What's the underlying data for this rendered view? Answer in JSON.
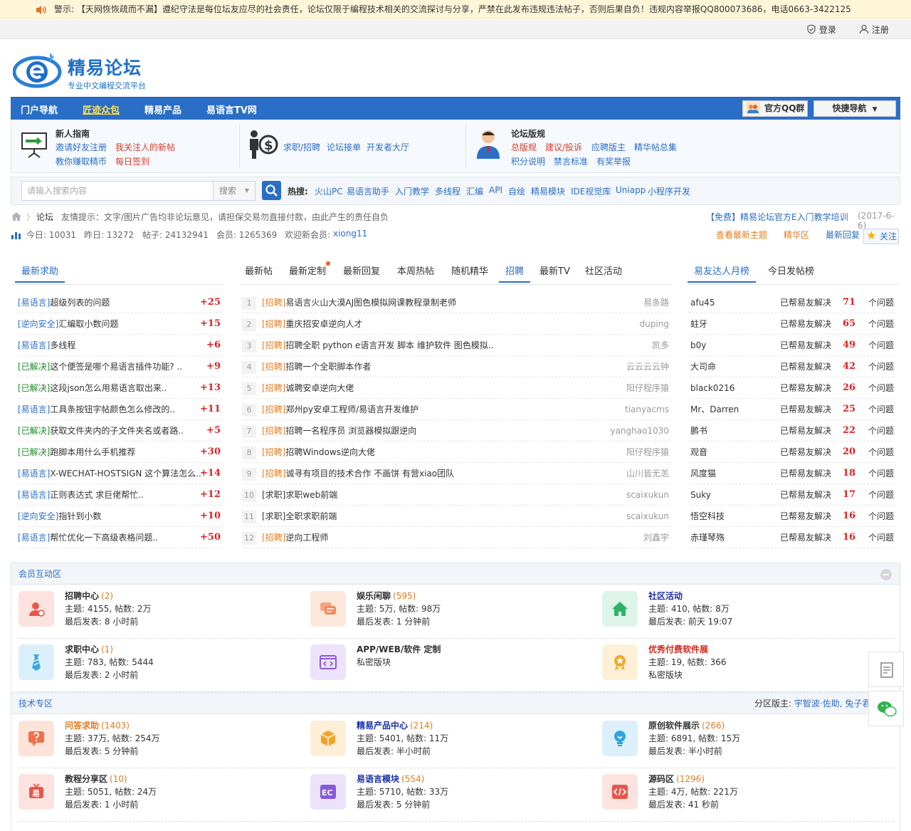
{
  "notice": {
    "label": "警示:",
    "text": "【天网恢恢疏而不漏】遵纪守法是每位坛友应尽的社会责任，论坛仅限于编程技术相关的交流探讨与分享，严禁在此发布违规违法帖子，否则后果自负！违规内容举报QQ800073686，电话0663-3422125"
  },
  "topbar": {
    "login": "登录",
    "register": "注册"
  },
  "logo": {
    "title": "精易论坛",
    "slogan": "专业中文编程交流平台"
  },
  "nav": {
    "items": [
      "门户导航",
      "匠迹众包",
      "精易产品",
      "易语言TV网"
    ],
    "qq_group": "官方QQ群",
    "quick_nav": "快捷导航"
  },
  "guide": {
    "newbie_title": "新人指南",
    "newbie_links": [
      "邀请好友注册",
      "我关注人的新帖",
      "教你赚取精币",
      "每日签到"
    ],
    "jobs_links": [
      "求职/招聘",
      "论坛接单",
      "开发者大厅"
    ],
    "rules_title": "论坛版规",
    "rules_links": [
      "总版规",
      "建议/投诉",
      "应聘版主",
      "精华帖总集",
      "积分说明",
      "禁言标准",
      "有奖举报"
    ]
  },
  "search": {
    "placeholder": "请输入搜索内容",
    "type": "搜索",
    "hot_label": "热搜:",
    "hot": [
      "火山PC",
      "易语言助手",
      "入门教学",
      "多线程",
      "汇编",
      "API",
      "自绘",
      "精易模块",
      "IDE视觉库",
      "Uniapp",
      "小程序开发"
    ]
  },
  "breadcrumb": {
    "current": "论坛",
    "tip": "友情提示：文字/图片广告均非论坛意见，请担保交易勿直接付款，由此产生的责任自负",
    "promo": "【免费】精易论坛官方E入门教学培训",
    "promo_date": "(2017-6-6)"
  },
  "stats": {
    "today": "今日: 10031",
    "yesterday": "昨日: 13272",
    "posts": "帖子: 24132941",
    "members": "会员: 1265369",
    "welcome": "欢迎新会员:",
    "newest": "xiong11",
    "links": [
      "查看最新主题",
      "精华区",
      "最新回复"
    ],
    "follow": "关注"
  },
  "help": {
    "tab": "最新求助",
    "rows": [
      {
        "tag": "[易语言]",
        "title": "超级列表的问题",
        "pts": "+25"
      },
      {
        "tag": "[逆向安全]",
        "title": "汇编取小数问题",
        "pts": "+15"
      },
      {
        "tag": "[易语言]",
        "title": "多线程",
        "pts": "+6"
      },
      {
        "tag": "[已解决]",
        "title": "这个便签是哪个易语言插件功能? ..",
        "pts": "+9"
      },
      {
        "tag": "[已解决]",
        "title": "这段json怎么用易语言取出来..",
        "pts": "+13"
      },
      {
        "tag": "[易语言]",
        "title": "工具条按钮字帖颜色怎么修改的..",
        "pts": "+11"
      },
      {
        "tag": "[已解决]",
        "title": "获取文件夹内的子文件夹名或者路..",
        "pts": "+5"
      },
      {
        "tag": "[已解决]",
        "title": "跑脚本用什么手机推荐",
        "pts": "+30"
      },
      {
        "tag": "[易语言]",
        "title": "X-WECHAT-HOSTSIGN 这个算法怎么..",
        "pts": "+14"
      },
      {
        "tag": "[易语言]",
        "title": "正则表达式 求巨佬帮忙..",
        "pts": "+12"
      },
      {
        "tag": "[逆向安全]",
        "title": "指针到小数",
        "pts": "+10"
      },
      {
        "tag": "[易语言]",
        "title": "帮忙优化一下高级表格问题..",
        "pts": "+50"
      }
    ]
  },
  "center": {
    "tabs": [
      "最新帖",
      "最新定制",
      "最新回复",
      "本周热帖",
      "随机精华",
      "招聘",
      "最新TV",
      "社区活动"
    ],
    "rows": [
      {
        "n": "1",
        "tag": "[招聘]",
        "title": "易语言火山大漠AJ图色模拟网课教程录制老师",
        "author": "易条路"
      },
      {
        "n": "2",
        "tag": "[招聘]",
        "title": "重庆招安卓逆向人才",
        "author": "duping"
      },
      {
        "n": "3",
        "tag": "[招聘]",
        "title": "招聘全职 python   e语言开发 脚本 维护软件   图色模拟..",
        "author": "凯多"
      },
      {
        "n": "4",
        "tag": "[招聘]",
        "title": "招聘一个全职脚本作者",
        "author": "云云云云钟"
      },
      {
        "n": "5",
        "tag": "[招聘]",
        "title": "诚聘安卓逆向大佬",
        "author": "阳仔程序猿"
      },
      {
        "n": "6",
        "tag": "[招聘]",
        "title": "郑州py安卓工程师/易语言开发维护",
        "author": "tianyacms"
      },
      {
        "n": "7",
        "tag": "[招聘]",
        "title": "招聘一名程序员 浏览器模拟跟逆向",
        "author": "yanghao1030"
      },
      {
        "n": "8",
        "tag": "[招聘]",
        "title": "招聘Windows逆向大佬",
        "author": "阳仔程序猿"
      },
      {
        "n": "9",
        "tag": "[招聘]",
        "title": "诚寻有项目的技术合作 不画饼 有营xiao团队",
        "author": "山川皆无恙"
      },
      {
        "n": "10",
        "tag": "[求职]",
        "title": "求职web前端",
        "author": "scaixukun"
      },
      {
        "n": "11",
        "tag": "[求职]",
        "title": "全职求职前端",
        "author": "scaixukun"
      },
      {
        "n": "12",
        "tag": "[招聘]",
        "title": "逆向工程师",
        "author": "刘鑫宇"
      }
    ]
  },
  "rank": {
    "tabs": [
      "易友达人月榜",
      "今日发帖榜"
    ],
    "solved_label": "已帮易友解决",
    "unit": "个问题",
    "rows": [
      {
        "name": "afu45",
        "n": "71"
      },
      {
        "name": "蛀牙",
        "n": "65"
      },
      {
        "name": "b0y",
        "n": "49"
      },
      {
        "name": "大司命",
        "n": "42"
      },
      {
        "name": "black0216",
        "n": "26"
      },
      {
        "name": "Mr、Darren",
        "n": "25"
      },
      {
        "name": "鹏书",
        "n": "22"
      },
      {
        "name": "观音",
        "n": "20"
      },
      {
        "name": "风度猫",
        "n": "18"
      },
      {
        "name": "Suky",
        "n": "17"
      },
      {
        "name": "悟空科技",
        "n": "16"
      },
      {
        "name": "赤瑾琴殇",
        "n": "16"
      }
    ]
  },
  "members_zone": {
    "title": "会员互动区",
    "forums": [
      {
        "name": "招聘中心",
        "count": "(2)",
        "l2": "主题: 4155, 帖数: 2万",
        "l3": "最后发表: 8 小时前",
        "color": "#333",
        "icon": "person-icon",
        "bg": "#fde3e0",
        "fg": "#e8564a"
      },
      {
        "name": "娱乐闲聊",
        "count": "(595)",
        "l2": "主题: 5万, 帖数: 98万",
        "l3": "最后发表: 1 分钟前",
        "color": "#333",
        "icon": "chat-icon",
        "bg": "#fde8db",
        "fg": "#f08a5d"
      },
      {
        "name": "社区活动",
        "count": "",
        "l2": "主题: 410, 帖数: 8万",
        "l3": "最后发表: 前天 19:07",
        "color": "#1a2ea8",
        "icon": "home-icon",
        "bg": "#dff5ea",
        "fg": "#2fb36b"
      },
      {
        "name": "求职中心",
        "count": "(1)",
        "l2": "主题: 783, 帖数: 5444",
        "l3": "最后发表: 2 小时前",
        "color": "#333",
        "icon": "tie-icon",
        "bg": "#dcf0fb",
        "fg": "#3aa7df"
      },
      {
        "name": "APP/WEB/软件 定制",
        "count": "",
        "l2": "私密版块",
        "l3": "",
        "color": "#333",
        "icon": "code-window-icon",
        "bg": "#ece3fa",
        "fg": "#8a5ad8"
      },
      {
        "name": "优秀付费软件展",
        "count": "",
        "l2": "主题: 19, 帖数: 366",
        "l3": "私密版块",
        "color": "#d8261b",
        "icon": "medal-icon",
        "bg": "#fdf0d6",
        "fg": "#f0a92a"
      }
    ]
  },
  "tech_zone": {
    "title": "技术专区",
    "moderators_label": "分区版主:",
    "moderators": "宇智波·佐助, 兔子君",
    "forums": [
      {
        "name": "问答求助",
        "count": "(1403)",
        "l2": "主题: 37万, 帖数: 254万",
        "l3": "最后发表: 5 分钟前",
        "color": "#e57a1e",
        "icon": "question-icon",
        "bg": "#fde3d8",
        "fg": "#f07048"
      },
      {
        "name": "精易产品中心",
        "count": "(214)",
        "l2": "主题: 5401, 帖数: 11万",
        "l3": "最后发表: 半小时前",
        "color": "#1a2ea8",
        "icon": "box-icon",
        "bg": "#fdefd6",
        "fg": "#f0a42a"
      },
      {
        "name": "原创软件展示",
        "count": "(266)",
        "l2": "主题: 6891, 帖数: 15万",
        "l3": "最后发表: 半小时前",
        "color": "#333",
        "icon": "bulb-icon",
        "bg": "#dcf0fb",
        "fg": "#2da5e0"
      },
      {
        "name": "教程分享区",
        "count": "(10)",
        "l2": "主题: 5051, 帖数: 24万",
        "l3": "最后发表: 1 小时前",
        "color": "#333",
        "icon": "tv-icon",
        "bg": "#fde3e0",
        "fg": "#e8564a"
      },
      {
        "name": "易语言模块",
        "count": "(554)",
        "l2": "主题: 5710, 帖数: 33万",
        "l3": "最后发表: 5 分钟前",
        "color": "#1a2ea8",
        "icon": "ec-icon",
        "bg": "#ece3fa",
        "fg": "#8a5ad8"
      },
      {
        "name": "源码区",
        "count": "(1296)",
        "l2": "主题: 4万, 帖数: 221万",
        "l3": "最后发表: 41 秒前",
        "color": "#333",
        "icon": "code-icon",
        "bg": "#fde3e0",
        "fg": "#e8564a"
      }
    ]
  }
}
